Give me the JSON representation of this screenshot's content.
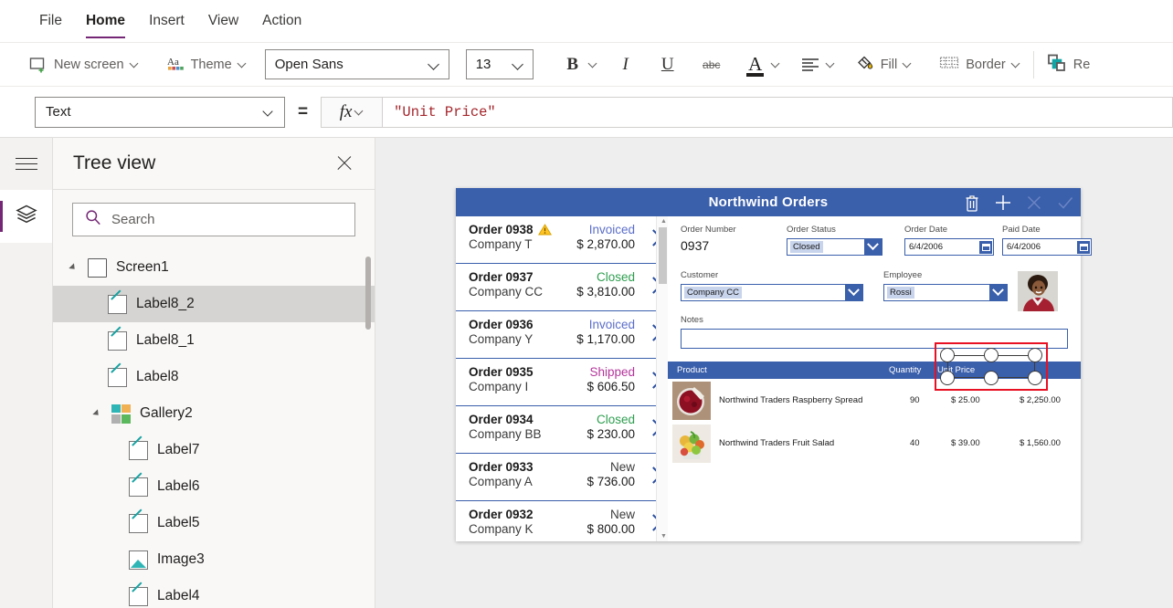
{
  "menubar": {
    "items": [
      {
        "label": "File",
        "active": false
      },
      {
        "label": "Home",
        "active": true
      },
      {
        "label": "Insert",
        "active": false
      },
      {
        "label": "View",
        "active": false
      },
      {
        "label": "Action",
        "active": false
      }
    ]
  },
  "ribbon": {
    "new_screen": "New screen",
    "theme": "Theme",
    "font_family": "Open Sans",
    "font_size": "13",
    "bold": "B",
    "italic": "I",
    "underline": "U",
    "strikethrough": "abc",
    "font_color": "A",
    "fill": "Fill",
    "border": "Border",
    "reorder": "Re"
  },
  "formula_bar": {
    "property": "Text",
    "equals": "=",
    "fx": "fx",
    "formula": "\"Unit Price\""
  },
  "tree_view": {
    "title": "Tree view",
    "search_placeholder": "Search",
    "items": [
      {
        "label": "Screen1",
        "icon": "screen-icon",
        "depth": 0,
        "expanded": true,
        "selected": false
      },
      {
        "label": "Label8_2",
        "icon": "label-icon",
        "depth": 1,
        "expanded": false,
        "selected": true
      },
      {
        "label": "Label8_1",
        "icon": "label-icon",
        "depth": 1,
        "expanded": false,
        "selected": false
      },
      {
        "label": "Label8",
        "icon": "label-icon",
        "depth": 1,
        "expanded": false,
        "selected": false
      },
      {
        "label": "Gallery2",
        "icon": "gallery-icon",
        "depth": 1,
        "expanded": true,
        "selected": false
      },
      {
        "label": "Label7",
        "icon": "label-icon",
        "depth": 2,
        "expanded": false,
        "selected": false
      },
      {
        "label": "Label6",
        "icon": "label-icon",
        "depth": 2,
        "expanded": false,
        "selected": false
      },
      {
        "label": "Label5",
        "icon": "label-icon",
        "depth": 2,
        "expanded": false,
        "selected": false
      },
      {
        "label": "Image3",
        "icon": "image-icon",
        "depth": 2,
        "expanded": false,
        "selected": false
      },
      {
        "label": "Label4",
        "icon": "label-icon",
        "depth": 2,
        "expanded": false,
        "selected": false
      }
    ]
  },
  "app": {
    "title": "Northwind Orders",
    "header_color": "#3a5fab",
    "header_icons": [
      "trash-icon",
      "plus-icon",
      "cancel-icon",
      "check-icon"
    ],
    "gallery": [
      {
        "order": "Order 0938",
        "company": "Company T",
        "status": "Invoiced",
        "status_color": "#5b6ec9",
        "amount": "$ 2,870.00",
        "warning": true
      },
      {
        "order": "Order 0937",
        "company": "Company CC",
        "status": "Closed",
        "status_color": "#2e9e4f",
        "amount": "$ 3,810.00",
        "warning": false
      },
      {
        "order": "Order 0936",
        "company": "Company Y",
        "status": "Invoiced",
        "status_color": "#5b6ec9",
        "amount": "$ 1,170.00",
        "warning": false
      },
      {
        "order": "Order 0935",
        "company": "Company I",
        "status": "Shipped",
        "status_color": "#b4359b",
        "amount": "$ 606.50",
        "warning": false
      },
      {
        "order": "Order 0934",
        "company": "Company BB",
        "status": "Closed",
        "status_color": "#2e9e4f",
        "amount": "$ 230.00",
        "warning": false
      },
      {
        "order": "Order 0933",
        "company": "Company A",
        "status": "New",
        "status_color": "#3b3b3b",
        "amount": "$ 736.00",
        "warning": false
      },
      {
        "order": "Order 0932",
        "company": "Company K",
        "status": "New",
        "status_color": "#3b3b3b",
        "amount": "$ 800.00",
        "warning": false
      }
    ],
    "form": {
      "order_number_label": "Order Number",
      "order_number_value": "0937",
      "order_status_label": "Order Status",
      "order_status_value": "Closed",
      "order_date_label": "Order Date",
      "order_date_value": "6/4/2006",
      "paid_date_label": "Paid Date",
      "paid_date_value": "6/4/2006",
      "customer_label": "Customer",
      "customer_value": "Company CC",
      "employee_label": "Employee",
      "employee_value": "Rossi",
      "notes_label": "Notes",
      "notes_value": ""
    },
    "products_table": {
      "columns": [
        "Product",
        "Quantity",
        "Unit Price",
        ""
      ],
      "rows": [
        {
          "product": "Northwind Traders Raspberry Spread",
          "quantity": "90",
          "unit_price": "$ 25.00",
          "total": "$ 2,250.00"
        },
        {
          "product": "Northwind Traders Fruit Salad",
          "quantity": "40",
          "unit_price": "$ 39.00",
          "total": "$ 1,560.00"
        }
      ]
    },
    "selection": {
      "target": "Unit Price",
      "border_color": "#e81123"
    }
  }
}
